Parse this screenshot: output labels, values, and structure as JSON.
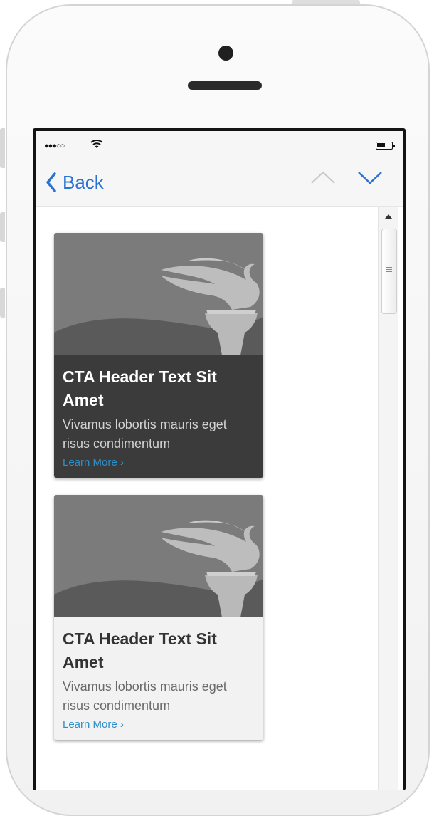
{
  "status_bar": {
    "signal_icon": "signal-dots-icon",
    "wifi_icon": "wifi-icon",
    "battery_icon": "battery-icon"
  },
  "navbar": {
    "back_label": "Back",
    "back_icon": "chevron-left-icon",
    "prev_icon": "chevron-up-icon",
    "next_icon": "chevron-down-icon",
    "accent_color": "#2b73d2"
  },
  "cards": [
    {
      "style": "dark",
      "image_icon": "torch-icon",
      "title": "CTA Header Text Sit Amet",
      "description": "Vivamus lobortis mauris eget risus condimentum",
      "link": "Learn More ›"
    },
    {
      "style": "light",
      "image_icon": "torch-icon",
      "title": "CTA Header Text Sit Amet",
      "description": "Vivamus lobortis mauris eget risus condimentum",
      "link": "Learn More ›"
    }
  ]
}
